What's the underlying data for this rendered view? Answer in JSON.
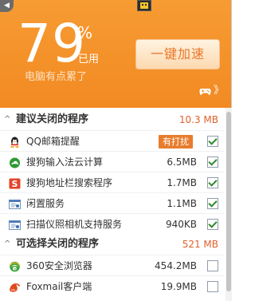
{
  "header": {
    "percent_value": "79",
    "percent_sign": "%",
    "used_label": "已用",
    "status_text": "电脑有点累了",
    "accelerate_button": "一键加速",
    "more_chevron": "》",
    "back_arrow": "◀"
  },
  "sections": [
    {
      "title": "建议关闭的程序",
      "total": "10.3 MB",
      "expanded": true,
      "items": [
        {
          "name": "QQ邮箱提醒",
          "size": "",
          "badge": "有打扰",
          "checked": true,
          "icon": "qq-penguin-icon"
        },
        {
          "name": "搜狗输入法云计算",
          "size": "6.5MB",
          "checked": true,
          "icon": "sogou-cloud-icon"
        },
        {
          "name": "搜狗地址栏搜索程序",
          "size": "1.7MB",
          "checked": true,
          "icon": "sogou-s-icon"
        },
        {
          "name": "闲置服务",
          "size": "1.1MB",
          "checked": true,
          "icon": "service-window-icon"
        },
        {
          "name": "扫描仪照相机支持服务",
          "size": "940KB",
          "checked": true,
          "icon": "service-window-icon"
        }
      ]
    },
    {
      "title": "可选择关闭的程序",
      "total": "521 MB",
      "expanded": true,
      "items": [
        {
          "name": "360安全浏览器",
          "size": "454.2MB",
          "checked": false,
          "icon": "browser-360-icon"
        },
        {
          "name": "Foxmail客户端",
          "size": "19.9MB",
          "checked": false,
          "icon": "foxmail-icon"
        }
      ]
    }
  ],
  "colors": {
    "header_orange": "#f28a22",
    "accent_size": "#e0612b",
    "badge_bg": "#e77d2c",
    "check_green": "#2d8a2d"
  }
}
